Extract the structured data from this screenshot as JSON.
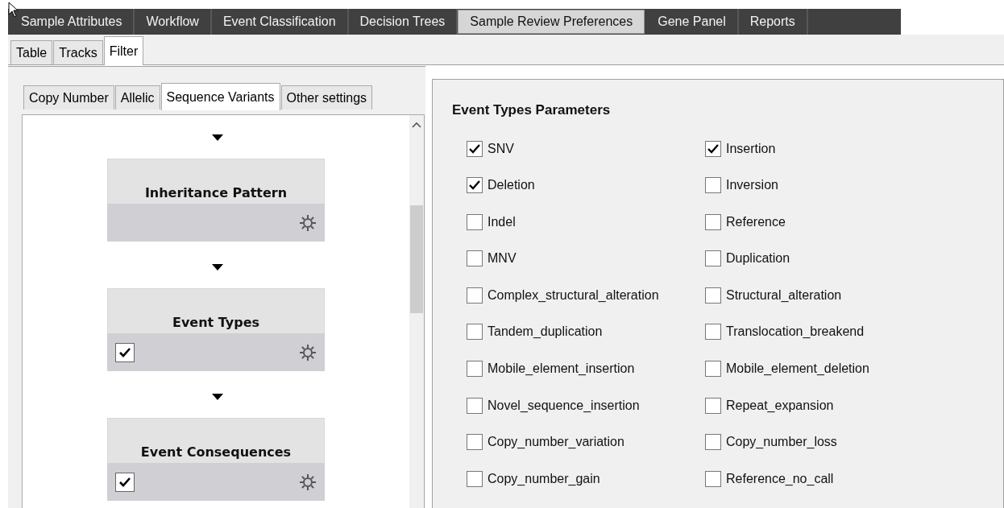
{
  "main_tabs": [
    {
      "label": "Sample Attributes",
      "selected": false
    },
    {
      "label": "Workflow",
      "selected": false
    },
    {
      "label": "Event Classification",
      "selected": false
    },
    {
      "label": "Decision Trees",
      "selected": false
    },
    {
      "label": "Sample Review Preferences",
      "selected": true
    },
    {
      "label": "Gene Panel",
      "selected": false
    },
    {
      "label": "Reports",
      "selected": false
    }
  ],
  "sub_tabs": [
    {
      "label": "Table",
      "selected": false
    },
    {
      "label": "Tracks",
      "selected": false
    },
    {
      "label": "Filter",
      "selected": true
    }
  ],
  "filter_tabs": [
    {
      "label": "Copy Number",
      "selected": false
    },
    {
      "label": "Allelic",
      "selected": false
    },
    {
      "label": "Sequence Variants",
      "selected": true
    },
    {
      "label": "Other settings",
      "selected": false
    }
  ],
  "flow_nodes": [
    {
      "title": "Inheritance Pattern",
      "kind": "plain"
    },
    {
      "title": "Event Types",
      "kind": "toggle",
      "checked": true
    },
    {
      "title": "Event Consequences",
      "kind": "toggle",
      "checked": true
    }
  ],
  "parameters": {
    "title": "Event Types Parameters",
    "options": [
      {
        "label": "SNV",
        "checked": true
      },
      {
        "label": "Insertion",
        "checked": true
      },
      {
        "label": "Deletion",
        "checked": true
      },
      {
        "label": "Inversion",
        "checked": false
      },
      {
        "label": "Indel",
        "checked": false
      },
      {
        "label": "Reference",
        "checked": false
      },
      {
        "label": "MNV",
        "checked": false
      },
      {
        "label": "Duplication",
        "checked": false
      },
      {
        "label": "Complex_structural_alteration",
        "checked": false
      },
      {
        "label": "Structural_alteration",
        "checked": false
      },
      {
        "label": "Tandem_duplication",
        "checked": false
      },
      {
        "label": "Translocation_breakend",
        "checked": false
      },
      {
        "label": "Mobile_element_insertion",
        "checked": false
      },
      {
        "label": "Mobile_element_deletion",
        "checked": false
      },
      {
        "label": "Novel_sequence_insertion",
        "checked": false
      },
      {
        "label": "Repeat_expansion",
        "checked": false
      },
      {
        "label": "Copy_number_variation",
        "checked": false
      },
      {
        "label": "Copy_number_loss",
        "checked": false
      },
      {
        "label": "Copy_number_gain",
        "checked": false
      },
      {
        "label": "Reference_no_call",
        "checked": false
      }
    ]
  }
}
